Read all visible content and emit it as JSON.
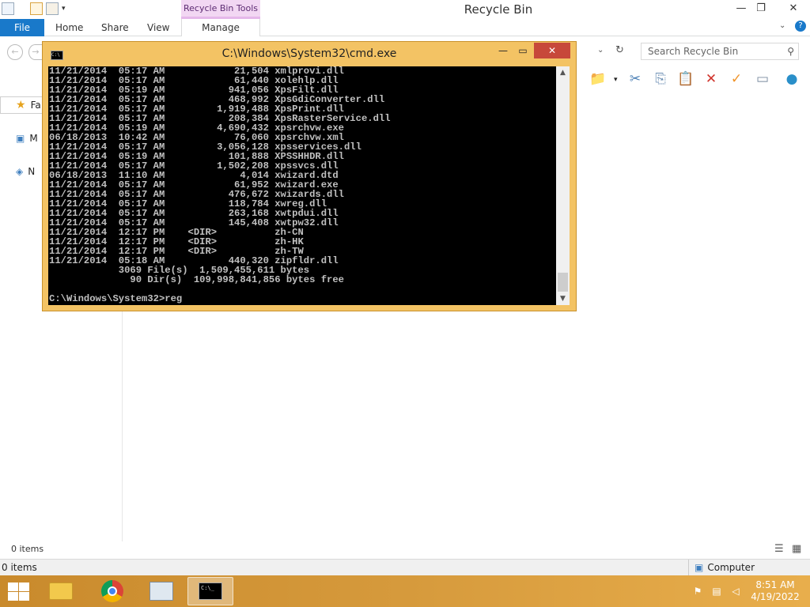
{
  "explorer": {
    "title": "Recycle Bin",
    "context_tab": "Recycle Bin Tools",
    "tabs": {
      "file": "File",
      "home": "Home",
      "share": "Share",
      "view": "View",
      "manage": "Manage"
    },
    "search_placeholder": "Search Recycle Bin",
    "nav": {
      "favorites": "Fa",
      "my_computer": "M",
      "network": "N"
    },
    "items_count": "0 items",
    "status_items": "0 items",
    "status_location": "Computer"
  },
  "cmd": {
    "title": "C:\\Windows\\System32\\cmd.exe",
    "lines": [
      "11/21/2014  05:17 AM            21,504 xmlprovi.dll",
      "11/21/2014  05:17 AM            61,440 xolehlp.dll",
      "11/21/2014  05:19 AM           941,056 XpsFilt.dll",
      "11/21/2014  05:17 AM           468,992 XpsGdiConverter.dll",
      "11/21/2014  05:17 AM         1,919,488 XpsPrint.dll",
      "11/21/2014  05:17 AM           208,384 XpsRasterService.dll",
      "11/21/2014  05:19 AM         4,690,432 xpsrchvw.exe",
      "06/18/2013  10:42 AM            76,060 xpsrchvw.xml",
      "11/21/2014  05:17 AM         3,056,128 xpsservices.dll",
      "11/21/2014  05:19 AM           101,888 XPSSHHDR.dll",
      "11/21/2014  05:17 AM         1,502,208 xpssvcs.dll",
      "06/18/2013  11:10 AM             4,014 xwizard.dtd",
      "11/21/2014  05:17 AM            61,952 xwizard.exe",
      "11/21/2014  05:17 AM           476,672 xwizards.dll",
      "11/21/2014  05:17 AM           118,784 xwreg.dll",
      "11/21/2014  05:17 AM           263,168 xwtpdui.dll",
      "11/21/2014  05:17 AM           145,408 xwtpw32.dll",
      "11/21/2014  12:17 PM    <DIR>          zh-CN",
      "11/21/2014  12:17 PM    <DIR>          zh-HK",
      "11/21/2014  12:17 PM    <DIR>          zh-TW",
      "11/21/2014  05:18 AM           440,320 zipfldr.dll",
      "            3069 File(s)  1,509,455,611 bytes",
      "              90 Dir(s)  109,998,841,856 bytes free",
      "",
      "C:\\Windows\\System32>reg"
    ]
  },
  "taskbar": {
    "time": "8:51 AM",
    "date": "4/19/2022"
  },
  "icons": {
    "min": "minimize-icon",
    "max": "maximize-icon",
    "close": "close-icon"
  }
}
